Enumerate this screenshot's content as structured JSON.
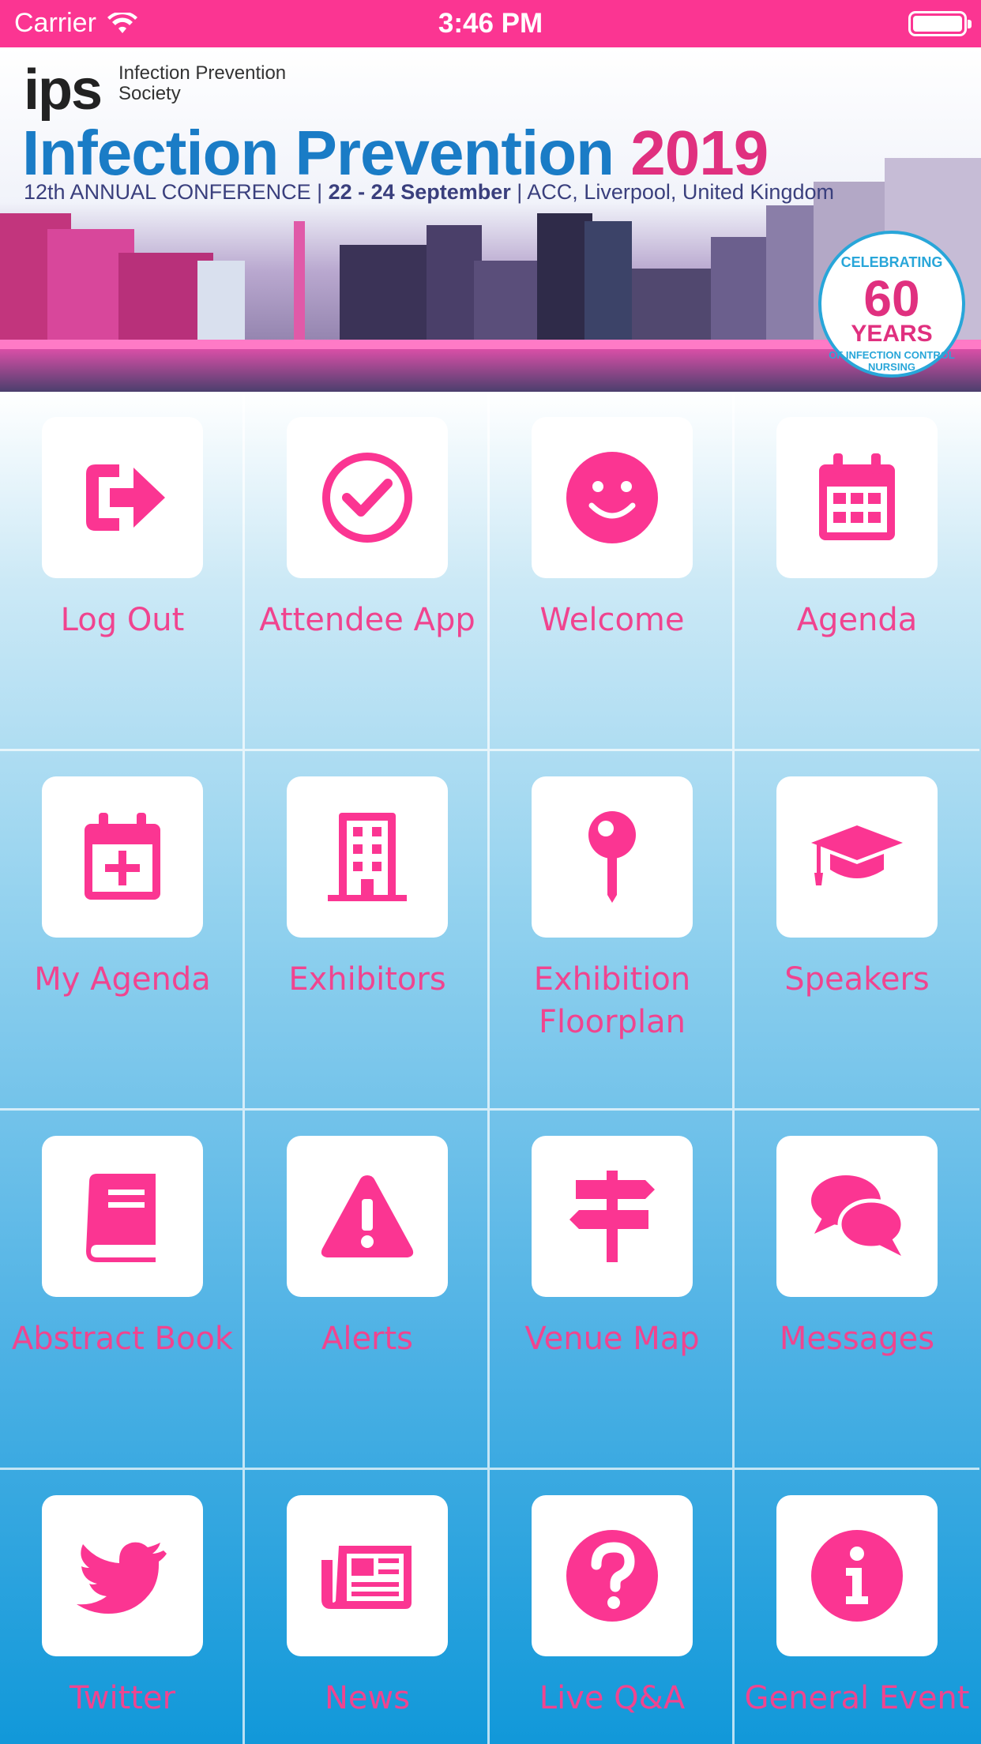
{
  "status_bar": {
    "carrier": "Carrier",
    "time": "3:46 PM"
  },
  "banner": {
    "org_logo": "ips",
    "org_name": "Infection Prevention Society",
    "title_main": "Infection Prevention",
    "title_year": "2019",
    "subtitle_left": "12th ANNUAL CONFERENCE |",
    "subtitle_dates": "22 - 24 September",
    "subtitle_right": "| ACC, Liverpool, United Kingdom",
    "badge_line1": "CELEBRATING",
    "badge_number": "60",
    "badge_years": "YEARS",
    "badge_line2": "OF INFECTION CONTROL NURSING"
  },
  "colors": {
    "accent": "#fb3592",
    "label": "#f0448f",
    "brand_blue": "#1a7cc6"
  },
  "tiles": [
    {
      "label": "Log Out",
      "icon": "sign-out-icon"
    },
    {
      "label": "Attendee App",
      "icon": "check-circle-icon"
    },
    {
      "label": "Welcome",
      "icon": "smile-icon"
    },
    {
      "label": "Agenda",
      "icon": "calendar-icon"
    },
    {
      "label": "My Agenda",
      "icon": "calendar-plus-icon"
    },
    {
      "label": "Exhibitors",
      "icon": "building-icon"
    },
    {
      "label": "Exhibition Floorplan",
      "icon": "map-pin-icon"
    },
    {
      "label": "Speakers",
      "icon": "graduation-cap-icon"
    },
    {
      "label": "Abstract Book",
      "icon": "book-icon"
    },
    {
      "label": "Alerts",
      "icon": "warning-icon"
    },
    {
      "label": "Venue Map",
      "icon": "signpost-icon"
    },
    {
      "label": "Messages",
      "icon": "comments-icon"
    },
    {
      "label": "Twitter",
      "icon": "twitter-icon"
    },
    {
      "label": "News",
      "icon": "newspaper-icon"
    },
    {
      "label": "Live Q&A",
      "icon": "question-circle-icon"
    },
    {
      "label": "General Event",
      "icon": "info-circle-icon"
    }
  ]
}
